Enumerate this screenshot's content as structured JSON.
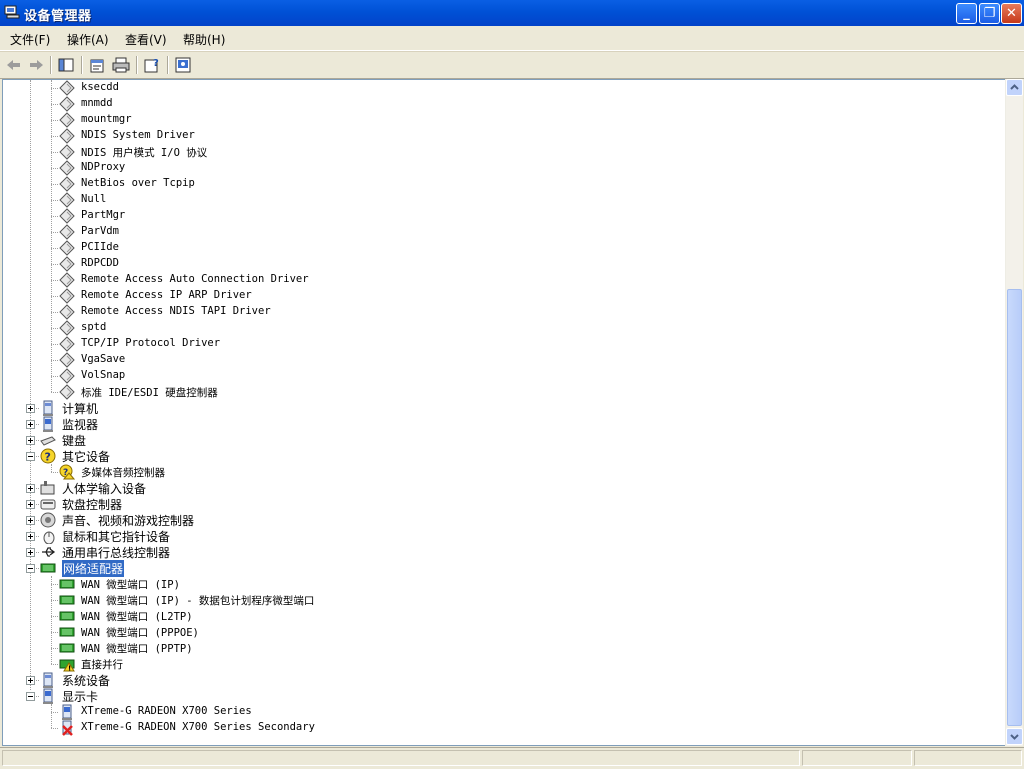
{
  "window": {
    "title": "设备管理器"
  },
  "menu": [
    {
      "label": "文件(F)"
    },
    {
      "label": "操作(A)"
    },
    {
      "label": "查看(V)"
    },
    {
      "label": "帮助(H)"
    }
  ],
  "toolbar": {
    "icons": [
      "back-arrow-icon",
      "forward-arrow-icon",
      "show-hide-tree-icon",
      "properties-icon",
      "print-icon",
      "help-icon",
      "device-display-icon"
    ]
  },
  "tree": {
    "drivers": [
      "ksecdd",
      "mnmdd",
      "mountmgr",
      "NDIS System Driver",
      "NDIS 用户模式 I/O 协议",
      "NDProxy",
      "NetBios over Tcpip",
      "Null",
      "PartMgr",
      "ParVdm",
      "PCIIde",
      "RDPCDD",
      "Remote Access Auto Connection Driver",
      "Remote Access IP ARP Driver",
      "Remote Access NDIS TAPI Driver",
      "sptd",
      "TCP/IP Protocol Driver",
      "VgaSave",
      "VolSnap",
      "标准 IDE/ESDI 硬盘控制器"
    ],
    "categories": {
      "computer": "计算机",
      "monitor": "监视器",
      "keyboard": "键盘",
      "other": "其它设备",
      "other_child": "多媒体音频控制器",
      "hid": "人体学输入设备",
      "floppy": "软盘控制器",
      "sound": "声音、视频和游戏控制器",
      "mouse": "鼠标和其它指针设备",
      "usb": "通用串行总线控制器",
      "network": "网络适配器",
      "system": "系统设备",
      "display": "显示卡"
    },
    "network_children": [
      "WAN 微型端口 (IP)",
      "WAN 微型端口 (IP) - 数据包计划程序微型端口",
      "WAN 微型端口 (L2TP)",
      "WAN 微型端口 (PPPOE)",
      "WAN 微型端口 (PPTP)",
      "直接并行"
    ],
    "display_children": [
      "XTreme-G RADEON X700 Series",
      "XTreme-G RADEON X700 Series Secondary"
    ]
  },
  "colors": {
    "selection": "#316AC5",
    "titlebar": "#0051D6"
  }
}
